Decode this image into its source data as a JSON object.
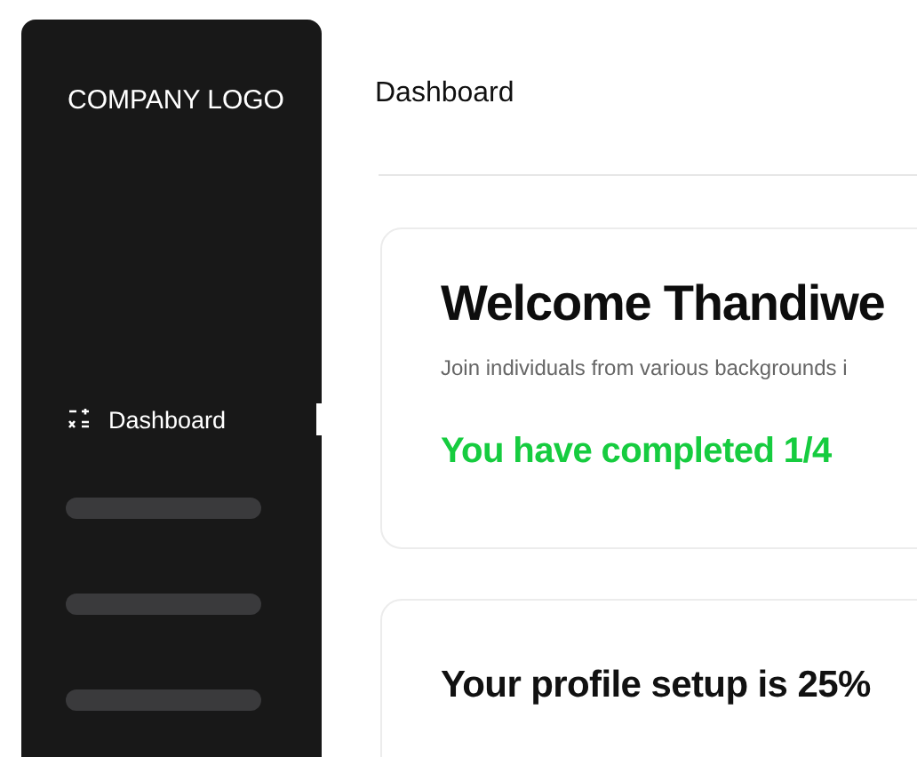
{
  "sidebar": {
    "logo": "COMPANY LOGO",
    "items": [
      {
        "kind": "link",
        "label": "Dashboard",
        "selected": true
      },
      {
        "kind": "placeholder"
      },
      {
        "kind": "placeholder"
      },
      {
        "kind": "placeholder"
      }
    ]
  },
  "header": {
    "title": "Dashboard"
  },
  "welcome_card": {
    "title": "Welcome Thandiwe",
    "subtitle": "Join individuals from various backgrounds i",
    "progress_text": "You have completed 1/4"
  },
  "profile_card": {
    "title": "Your profile setup is 25%"
  }
}
